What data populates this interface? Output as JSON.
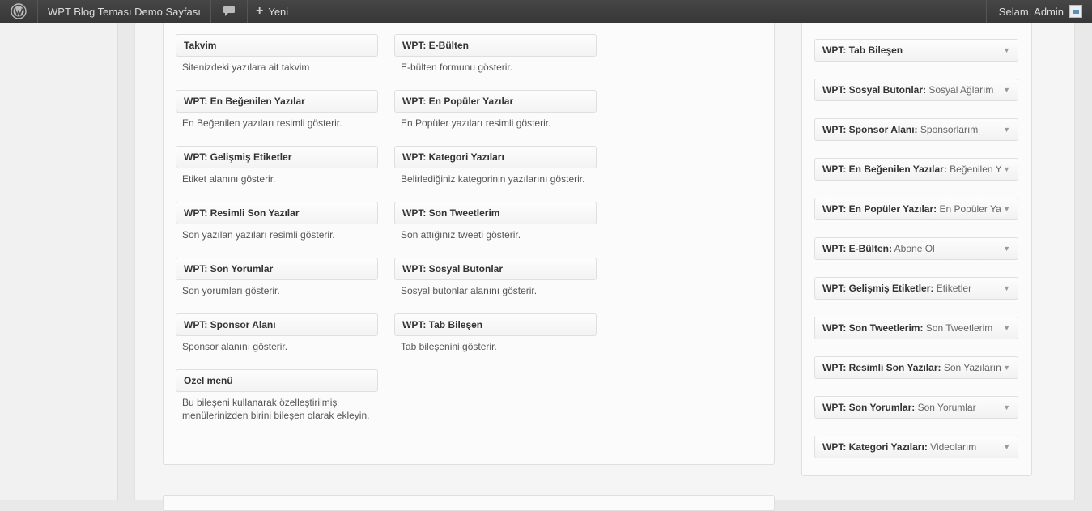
{
  "adminbar": {
    "site_name": "WPT Blog Teması Demo Sayfası",
    "new_label": "Yeni",
    "greeting": "Selam, Admin"
  },
  "available_widgets": [
    {
      "title": "Takvim",
      "desc": "Sitenizdeki yazılara ait takvim"
    },
    {
      "title": "WPT: E-Bülten",
      "desc": "E-bülten formunu gösterir."
    },
    {
      "title": "WPT: En Beğenilen Yazılar",
      "desc": "En Beğenilen yazıları resimli gösterir."
    },
    {
      "title": "WPT: En Popüler Yazılar",
      "desc": "En Popüler yazıları resimli gösterir."
    },
    {
      "title": "WPT: Gelişmiş Etiketler",
      "desc": "Etiket alanını gösterir."
    },
    {
      "title": "WPT: Kategori Yazıları",
      "desc": "Belirlediğiniz kategorinin yazılarını gösterir."
    },
    {
      "title": "WPT: Resimli Son Yazılar",
      "desc": "Son yazılan yazıları resimli gösterir."
    },
    {
      "title": "WPT: Son Tweetlerim",
      "desc": "Son attığınız tweeti gösterir."
    },
    {
      "title": "WPT: Son Yorumlar",
      "desc": "Son yorumları gösterir."
    },
    {
      "title": "WPT: Sosyal Butonlar",
      "desc": "Sosyal butonlar alanını gösterir."
    },
    {
      "title": "WPT: Sponsor Alanı",
      "desc": "Sponsor alanını gösterir."
    },
    {
      "title": "WPT: Tab Bileşen",
      "desc": "Tab bileşenini gösterir."
    },
    {
      "title": "Ozel menü",
      "desc": "Bu bileşeni kullanarak özelleştirilmiş menülerinizden birini bileşen olarak ekleyin."
    }
  ],
  "sidebar_widgets": [
    {
      "name": "WPT: Tab Bileşen",
      "instance": ""
    },
    {
      "name": "WPT: Sosyal Butonlar:",
      "instance": "Sosyal Ağlarım"
    },
    {
      "name": "WPT: Sponsor Alanı:",
      "instance": "Sponsorlarım"
    },
    {
      "name": "WPT: En Beğenilen Yazılar:",
      "instance": "Beğenilen Y"
    },
    {
      "name": "WPT: En Popüler Yazılar:",
      "instance": "En Popüler Ya"
    },
    {
      "name": "WPT: E-Bülten:",
      "instance": "Abone Ol"
    },
    {
      "name": "WPT: Gelişmiş Etiketler:",
      "instance": "Etiketler"
    },
    {
      "name": "WPT: Son Tweetlerim:",
      "instance": "Son Tweetlerim"
    },
    {
      "name": "WPT: Resimli Son Yazılar:",
      "instance": "Son Yazıların"
    },
    {
      "name": "WPT: Son Yorumlar:",
      "instance": "Son Yorumlar"
    },
    {
      "name": "WPT: Kategori Yazıları:",
      "instance": "Videolarım"
    }
  ],
  "icons": {
    "wp": "wordpress-logo-icon",
    "comments": "comment-bubble-icon",
    "plus": "plus-icon",
    "toggle": "arrow-down-icon"
  }
}
